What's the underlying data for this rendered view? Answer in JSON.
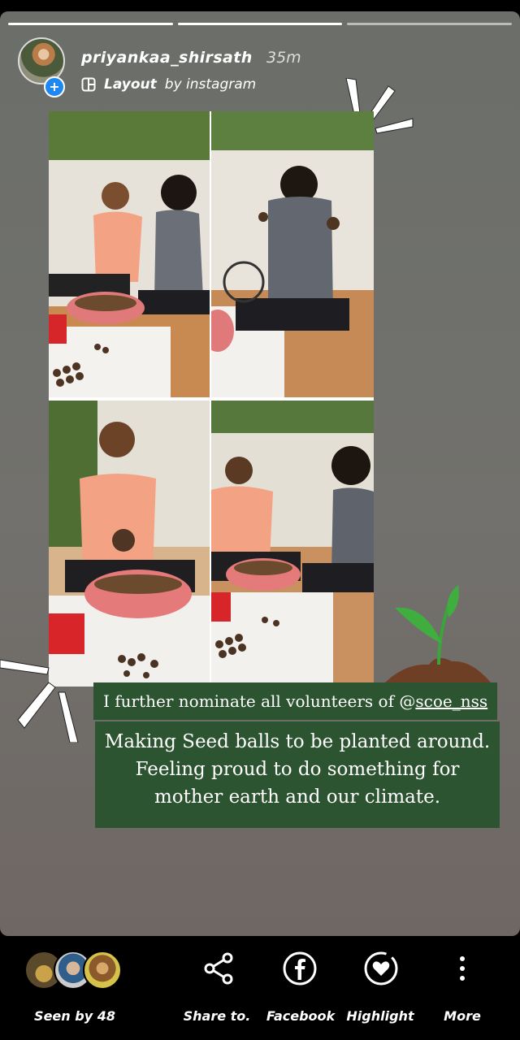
{
  "header": {
    "username": "priyankaa_shirsath",
    "time": "35m",
    "layout_label": "Layout",
    "layout_sub": "by instagram"
  },
  "nominate": {
    "prefix": "I further nominate all volunteers of @",
    "handle": "scoe_nss"
  },
  "caption": {
    "line1": "Making Seed balls to be planted around.",
    "line2": "Feeling proud to do something for",
    "line3": "mother earth and our climate."
  },
  "bottom_bar": {
    "seen_by": "Seen by 48",
    "share": "Share to.",
    "facebook": "Facebook",
    "highlight": "Highlight",
    "more": "More"
  },
  "icons": {
    "share": "share-icon",
    "facebook": "facebook-icon",
    "highlight": "highlight-heart-icon",
    "more": "more-vertical-icon",
    "sprout": "sprout-icon"
  },
  "colors": {
    "caption_bg": "#2c5430",
    "accent_blue": "#1e88f0"
  }
}
